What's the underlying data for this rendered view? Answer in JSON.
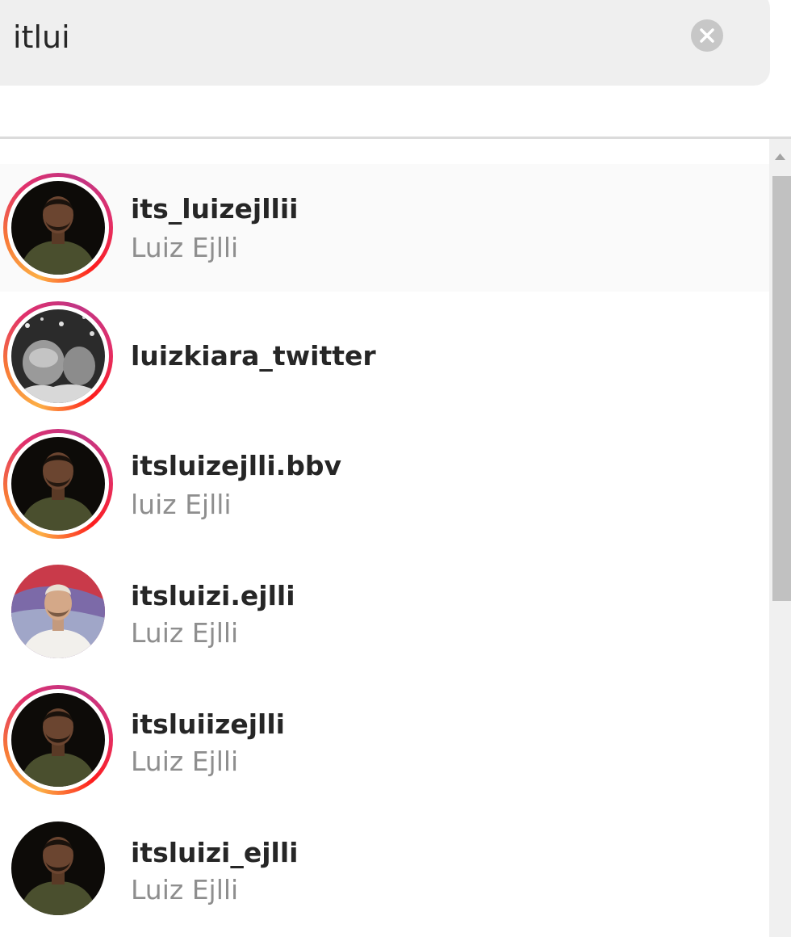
{
  "search": {
    "value": "itlui",
    "clear_icon": "close-circle-icon"
  },
  "results": [
    {
      "username": "its_luizejllii",
      "full_name": "Luiz Ejlli",
      "has_story_ring": true,
      "avatar": "man-dark-background"
    },
    {
      "username": "luizkiara_twitter",
      "full_name": "",
      "has_story_ring": true,
      "avatar": "black-and-white-photo"
    },
    {
      "username": "itsluizejlli.bbv",
      "full_name": "luiz Ejlli",
      "has_story_ring": true,
      "avatar": "man-dark-background"
    },
    {
      "username": "itsluizi.ejlli",
      "full_name": "Luiz Ejlli",
      "has_story_ring": false,
      "avatar": "man-white-shirt-red-background"
    },
    {
      "username": "itsluiizejlli",
      "full_name": "Luiz Ejlli",
      "has_story_ring": true,
      "avatar": "man-dark-background"
    },
    {
      "username": "itsluizi_ejlli",
      "full_name": "Luiz Ejlli",
      "has_story_ring": false,
      "avatar": "man-dark-background"
    }
  ],
  "colors": {
    "search_background": "#efefef",
    "story_ring": [
      "#fcaf45",
      "#e1306c",
      "#c13584"
    ],
    "username_text": "#262626",
    "secondary_text": "#8e8e8e"
  }
}
